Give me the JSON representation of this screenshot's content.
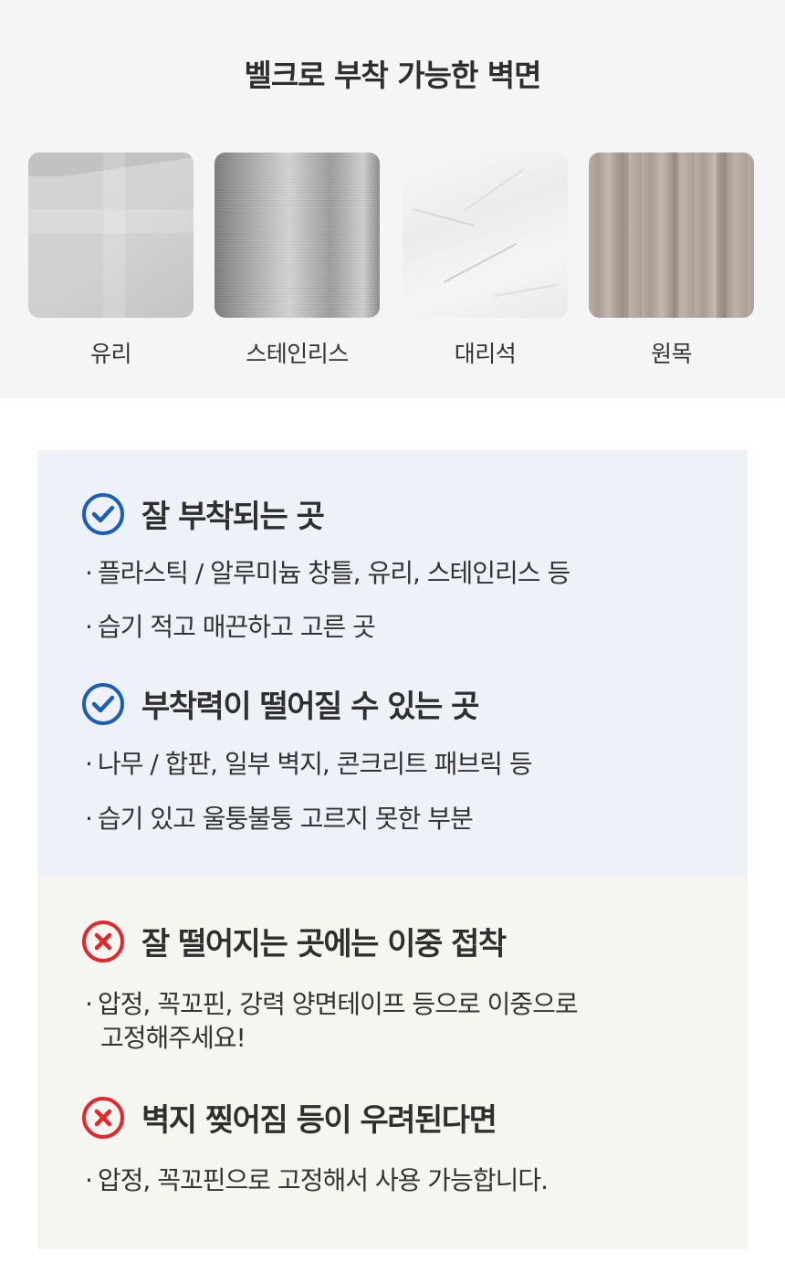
{
  "header": {
    "title": "벨크로 부착 가능한 벽면"
  },
  "surfaces": [
    {
      "label": "유리",
      "texture": "glass"
    },
    {
      "label": "스테인리스",
      "texture": "stainless"
    },
    {
      "label": "대리석",
      "texture": "marble"
    },
    {
      "label": "원목",
      "texture": "wood"
    }
  ],
  "good": {
    "icon": "check-circle-icon",
    "color": "#1a5fb4",
    "title": "잘 부착되는 곳",
    "bullets": [
      "플라스틱 / 알루미늄 창틀, 유리, 스테인리스 등",
      "습기 적고 매끈하고 고른 곳"
    ]
  },
  "weak": {
    "icon": "check-circle-icon",
    "color": "#1a5fb4",
    "title": "부착력이 떨어질 수 있는 곳",
    "bullets": [
      "나무 / 합판, 일부 벽지, 콘크리트 패브릭 등",
      "습기 있고 울퉁불퉁 고르지 못한 부분"
    ]
  },
  "tip1": {
    "icon": "x-circle-icon",
    "color": "#e2272f",
    "title": "잘 떨어지는 곳에는 이중 접착",
    "bullet_line1": "압정, 꼭꼬핀, 강력 양면테이프 등으로 이중으로",
    "bullet_line2": "고정해주세요!"
  },
  "tip2": {
    "icon": "x-circle-icon",
    "color": "#e2272f",
    "title": "벽지 찢어짐 등이 우려된다면",
    "bullets": [
      "압정, 꼭꼬핀으로 고정해서 사용 가능합니다."
    ]
  },
  "bullet_symbol": "·"
}
